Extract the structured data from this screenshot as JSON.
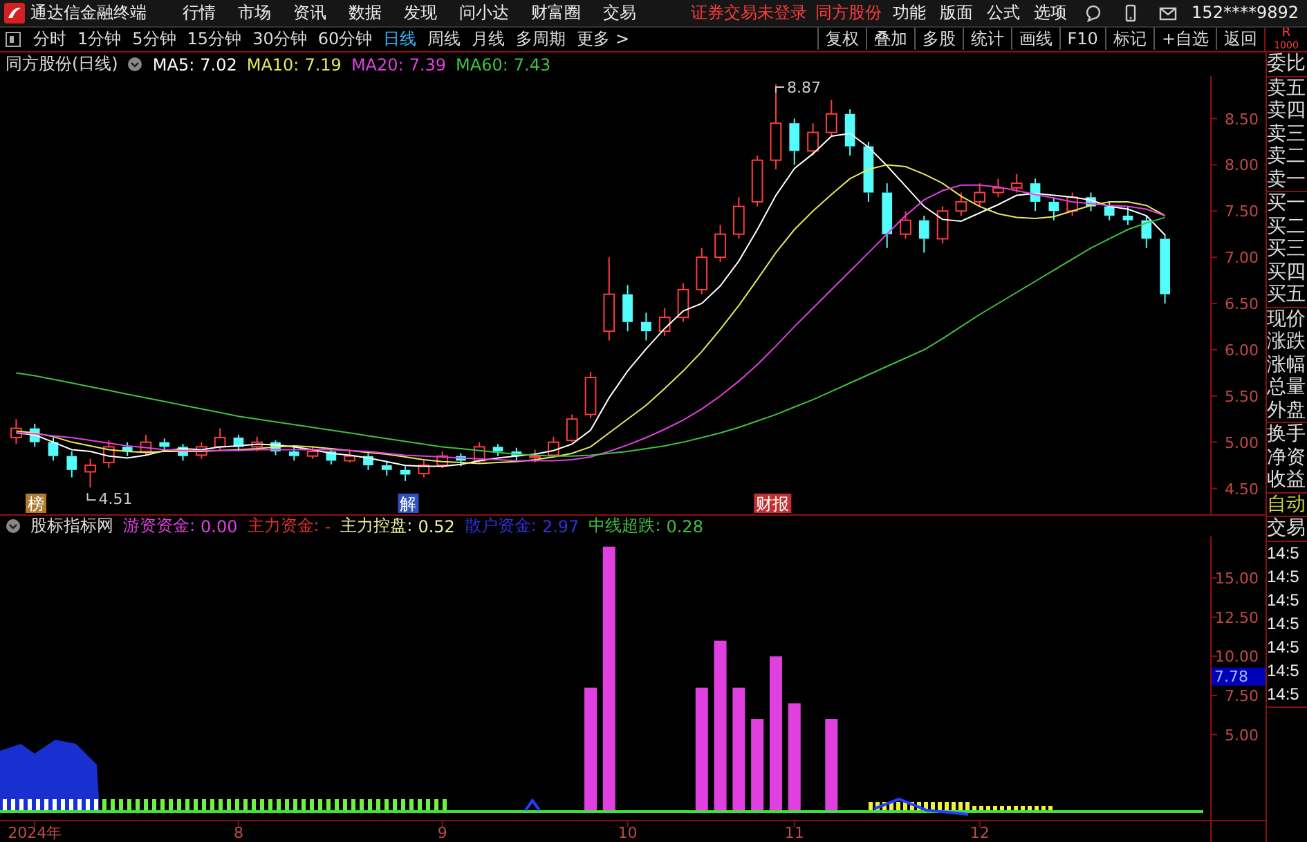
{
  "menubar": {
    "app_title": "通达信金融终端",
    "menus": [
      "行情",
      "市场",
      "资讯",
      "数据",
      "发现",
      "问小达",
      "财富圈",
      "交易"
    ],
    "notices": [
      "证券交易未登录",
      "同方股份"
    ],
    "actions": [
      "功能",
      "版面",
      "公式",
      "选项"
    ],
    "account": "152****9892"
  },
  "toolbar": {
    "periods": [
      {
        "label": "分时",
        "selected": false
      },
      {
        "label": "1分钟",
        "selected": false
      },
      {
        "label": "5分钟",
        "selected": false
      },
      {
        "label": "15分钟",
        "selected": false
      },
      {
        "label": "30分钟",
        "selected": false
      },
      {
        "label": "60分钟",
        "selected": false
      },
      {
        "label": "日线",
        "selected": true
      },
      {
        "label": "周线",
        "selected": false
      },
      {
        "label": "月线",
        "selected": false
      },
      {
        "label": "多周期",
        "selected": false
      },
      {
        "label": "更多 >",
        "selected": false
      }
    ],
    "buttons": [
      "复权",
      "叠加",
      "多股",
      "统计",
      "画线",
      "F10",
      "标记",
      "+自选",
      "返回"
    ],
    "corner": [
      "R",
      "1000"
    ]
  },
  "chart": {
    "title": "同方股份(日线)",
    "legend": [
      {
        "value": "7.02"
      },
      {
        "value": "7.19"
      },
      {
        "value": "7.39"
      },
      {
        "value": "7.43"
      }
    ],
    "events": [
      {
        "text": "榜",
        "color": "#b07a30"
      },
      {
        "text": "解",
        "color": "#3050c0"
      },
      {
        "text": "财报",
        "color": "#c03030"
      }
    ],
    "chart_data": {
      "type": "candlestick",
      "ylim": [
        4.22,
        8.96
      ],
      "categories": [
        null,
        null,
        null,
        null,
        null,
        null,
        null,
        null,
        null,
        null,
        null,
        null,
        null,
        null,
        null,
        null,
        null,
        null,
        null,
        null,
        null,
        null,
        null,
        null,
        null,
        null,
        null,
        null,
        null,
        null,
        null,
        null,
        null,
        null,
        null,
        null,
        null,
        null,
        null,
        null,
        null,
        null,
        null,
        null,
        null,
        null,
        null,
        null,
        null,
        null,
        null,
        null,
        null,
        null,
        null,
        null,
        null,
        null,
        null,
        null,
        null,
        null,
        null
      ],
      "yticks": [
        {
          "value": 4.5,
          "label": "4.50"
        },
        {
          "value": 5,
          "label": "5.00"
        },
        {
          "value": 5.5,
          "label": "5.50"
        },
        {
          "value": 6,
          "label": "6.00"
        },
        {
          "value": 6.5,
          "label": "6.50"
        },
        {
          "value": 7,
          "label": "7.00"
        },
        {
          "value": 7.5,
          "label": "7.50"
        },
        {
          "value": 8,
          "label": "8.00"
        },
        {
          "value": 8.5,
          "label": "8.50"
        }
      ],
      "ohlc": [
        [
          5.05,
          5.25,
          4.98,
          5.15
        ],
        [
          5.15,
          5.2,
          4.95,
          5.0
        ],
        [
          5.0,
          5.05,
          4.8,
          4.85
        ],
        [
          4.85,
          4.9,
          4.62,
          4.7
        ],
        [
          4.68,
          4.82,
          4.51,
          4.75
        ],
        [
          4.78,
          5.02,
          4.72,
          4.95
        ],
        [
          4.95,
          5.0,
          4.85,
          4.9
        ],
        [
          4.9,
          5.08,
          4.86,
          5.0
        ],
        [
          5.0,
          5.04,
          4.9,
          4.95
        ],
        [
          4.95,
          4.98,
          4.8,
          4.85
        ],
        [
          4.86,
          5.0,
          4.82,
          4.95
        ],
        [
          4.95,
          5.15,
          4.9,
          5.05
        ],
        [
          5.05,
          5.08,
          4.9,
          4.95
        ],
        [
          4.95,
          5.06,
          4.9,
          5.0
        ],
        [
          5.0,
          5.02,
          4.86,
          4.9
        ],
        [
          4.9,
          4.95,
          4.8,
          4.85
        ],
        [
          4.85,
          4.96,
          4.82,
          4.9
        ],
        [
          4.9,
          4.93,
          4.76,
          4.8
        ],
        [
          4.8,
          4.92,
          4.78,
          4.85
        ],
        [
          4.85,
          4.88,
          4.7,
          4.75
        ],
        [
          4.75,
          4.8,
          4.64,
          4.7
        ],
        [
          4.7,
          4.74,
          4.58,
          4.65
        ],
        [
          4.66,
          4.8,
          4.62,
          4.75
        ],
        [
          4.75,
          4.9,
          4.72,
          4.85
        ],
        [
          4.85,
          4.88,
          4.74,
          4.8
        ],
        [
          4.8,
          5.0,
          4.78,
          4.95
        ],
        [
          4.95,
          4.98,
          4.85,
          4.9
        ],
        [
          4.9,
          4.94,
          4.8,
          4.85
        ],
        [
          4.84,
          4.92,
          4.78,
          4.85
        ],
        [
          4.86,
          5.06,
          4.84,
          5.0
        ],
        [
          5.02,
          5.3,
          5.0,
          5.25
        ],
        [
          5.3,
          5.76,
          5.26,
          5.7
        ],
        [
          6.2,
          7.0,
          6.1,
          6.6
        ],
        [
          6.6,
          6.7,
          6.2,
          6.3
        ],
        [
          6.3,
          6.4,
          6.1,
          6.2
        ],
        [
          6.2,
          6.45,
          6.15,
          6.35
        ],
        [
          6.35,
          6.72,
          6.3,
          6.65
        ],
        [
          6.65,
          7.1,
          6.6,
          7.0
        ],
        [
          7.0,
          7.35,
          6.95,
          7.25
        ],
        [
          7.25,
          7.65,
          7.2,
          7.55
        ],
        [
          7.6,
          8.1,
          7.55,
          8.05
        ],
        [
          8.05,
          8.87,
          7.95,
          8.45
        ],
        [
          8.45,
          8.5,
          8.0,
          8.15
        ],
        [
          8.15,
          8.45,
          8.1,
          8.35
        ],
        [
          8.35,
          8.7,
          8.3,
          8.55
        ],
        [
          8.55,
          8.6,
          8.1,
          8.2
        ],
        [
          8.2,
          8.25,
          7.6,
          7.7
        ],
        [
          7.7,
          7.8,
          7.1,
          7.25
        ],
        [
          7.25,
          7.5,
          7.2,
          7.4
        ],
        [
          7.4,
          7.45,
          7.05,
          7.2
        ],
        [
          7.2,
          7.55,
          7.15,
          7.5
        ],
        [
          7.5,
          7.7,
          7.45,
          7.6
        ],
        [
          7.6,
          7.8,
          7.55,
          7.7
        ],
        [
          7.7,
          7.85,
          7.65,
          7.75
        ],
        [
          7.75,
          7.9,
          7.7,
          7.8
        ],
        [
          7.8,
          7.85,
          7.5,
          7.6
        ],
        [
          7.6,
          7.65,
          7.4,
          7.5
        ],
        [
          7.5,
          7.7,
          7.45,
          7.65
        ],
        [
          7.65,
          7.7,
          7.5,
          7.55
        ],
        [
          7.55,
          7.6,
          7.4,
          7.45
        ],
        [
          7.45,
          7.55,
          7.35,
          7.4
        ],
        [
          7.4,
          7.45,
          7.1,
          7.2
        ],
        [
          7.2,
          7.25,
          6.5,
          6.6
        ]
      ],
      "series": [
        {
          "name": "MA5:",
          "type": "line",
          "color": "#ffffff",
          "values": [
            5.1,
            5.08,
            5.0,
            4.92,
            4.9,
            4.85,
            4.83,
            4.86,
            4.91,
            4.93,
            4.92,
            4.95,
            4.96,
            4.98,
            4.97,
            4.95,
            4.92,
            4.88,
            4.86,
            4.83,
            4.79,
            4.75,
            4.74,
            4.74,
            4.76,
            4.8,
            4.83,
            4.85,
            4.87,
            4.91,
            4.98,
            5.13,
            5.48,
            5.77,
            6.01,
            6.23,
            6.42,
            6.5,
            6.69,
            6.96,
            7.3,
            7.67,
            7.96,
            8.12,
            8.31,
            8.34,
            8.19,
            7.99,
            7.77,
            7.55,
            7.41,
            7.39,
            7.48,
            7.57,
            7.67,
            7.69,
            7.67,
            7.65,
            7.62,
            7.55,
            7.52,
            7.45,
            7.24
          ]
        },
        {
          "name": "MA10:",
          "type": "line",
          "color": "#e8e85a",
          "values": [
            5.12,
            5.1,
            5.06,
            5.0,
            4.96,
            4.92,
            4.9,
            4.89,
            4.9,
            4.9,
            4.9,
            4.91,
            4.92,
            4.93,
            4.95,
            4.96,
            4.95,
            4.93,
            4.91,
            4.89,
            4.87,
            4.84,
            4.81,
            4.79,
            4.78,
            4.77,
            4.78,
            4.79,
            4.81,
            4.84,
            4.88,
            4.95,
            5.1,
            5.25,
            5.4,
            5.58,
            5.77,
            5.98,
            6.22,
            6.48,
            6.76,
            7.05,
            7.3,
            7.5,
            7.68,
            7.85,
            7.95,
            8.0,
            7.98,
            7.9,
            7.8,
            7.66,
            7.55,
            7.47,
            7.43,
            7.42,
            7.44,
            7.5,
            7.56,
            7.6,
            7.6,
            7.56,
            7.45
          ]
        },
        {
          "name": "MA20:",
          "type": "line",
          "color": "#e040e0",
          "values": [
            5.1,
            5.09,
            5.07,
            5.05,
            5.02,
            4.99,
            4.96,
            4.94,
            4.92,
            4.91,
            4.91,
            4.91,
            4.91,
            4.92,
            4.92,
            4.92,
            4.92,
            4.92,
            4.91,
            4.9,
            4.88,
            4.86,
            4.85,
            4.84,
            4.83,
            4.82,
            4.81,
            4.8,
            4.8,
            4.8,
            4.81,
            4.84,
            4.9,
            4.97,
            5.05,
            5.14,
            5.24,
            5.36,
            5.5,
            5.66,
            5.84,
            6.04,
            6.25,
            6.45,
            6.65,
            6.85,
            7.05,
            7.25,
            7.45,
            7.62,
            7.72,
            7.78,
            7.78,
            7.76,
            7.72,
            7.68,
            7.64,
            7.6,
            7.58,
            7.56,
            7.55,
            7.52,
            7.45
          ]
        },
        {
          "name": "MA60:",
          "type": "line",
          "color": "#40c040",
          "values": [
            5.75,
            5.72,
            5.68,
            5.64,
            5.6,
            5.56,
            5.52,
            5.48,
            5.44,
            5.4,
            5.36,
            5.32,
            5.28,
            5.25,
            5.22,
            5.19,
            5.16,
            5.13,
            5.1,
            5.07,
            5.04,
            5.01,
            4.98,
            4.95,
            4.93,
            4.91,
            4.89,
            4.87,
            4.86,
            4.85,
            4.85,
            4.86,
            4.88,
            4.9,
            4.93,
            4.96,
            5.0,
            5.05,
            5.1,
            5.16,
            5.23,
            5.3,
            5.38,
            5.46,
            5.55,
            5.64,
            5.73,
            5.82,
            5.91,
            6.0,
            6.12,
            6.25,
            6.38,
            6.5,
            6.62,
            6.74,
            6.86,
            6.98,
            7.1,
            7.2,
            7.3,
            7.37,
            7.43
          ]
        }
      ],
      "annotations": [
        "8.87",
        "4.51"
      ]
    }
  },
  "indicator": {
    "title": "股标指标网",
    "legend": [
      {
        "value": "0.00"
      },
      {
        "name": "主力资金:",
        "value": "-",
        "color": "#e03030"
      },
      {
        "name": "主力控盘:",
        "value": "0.52",
        "color": "#f0f0a0"
      },
      {
        "name": "散户资金:",
        "value": "2.97",
        "color": "#3030e0"
      },
      {
        "name": "中线超跌:",
        "value": "0.28",
        "color": "#40c040"
      }
    ],
    "current_value": "7.78",
    "chart_data": {
      "type": "bar",
      "ylim": [
        0,
        17.65
      ],
      "categories": [
        null,
        "2024年",
        null,
        null,
        null,
        null,
        null,
        null,
        null,
        null,
        null,
        null,
        "8",
        null,
        null,
        null,
        null,
        null,
        null,
        null,
        null,
        null,
        null,
        "9",
        null,
        null,
        null,
        null,
        null,
        null,
        null,
        null,
        null,
        "10",
        null,
        null,
        null,
        null,
        null,
        null,
        null,
        null,
        "11",
        null,
        null,
        null,
        null,
        null,
        null,
        null,
        null,
        null,
        "12",
        null,
        null,
        null,
        null,
        null,
        null,
        null,
        null,
        null,
        null
      ],
      "yticks": [
        {
          "value": 5,
          "label": "5.00"
        },
        {
          "value": 7.5,
          "label": "7.50"
        },
        {
          "value": 10,
          "label": "10.00"
        },
        {
          "value": 12.5,
          "label": "12.50"
        },
        {
          "value": 15,
          "label": "15.00"
        }
      ],
      "series": [
        {
          "name": "游资资金:",
          "color": "#e040e0",
          "values": [
            0,
            0,
            0,
            0,
            0,
            0,
            0,
            0,
            0,
            0,
            0,
            0,
            0,
            0,
            0,
            0,
            0,
            0,
            0,
            0,
            0,
            0,
            0,
            0,
            0,
            0,
            0,
            0,
            0,
            0,
            0,
            8,
            17,
            0,
            0,
            0,
            0,
            8,
            11,
            8,
            6,
            10,
            7,
            0,
            6,
            0,
            0,
            0,
            0,
            0,
            0,
            0,
            0,
            0,
            0,
            0,
            0,
            0,
            0,
            0,
            0,
            0,
            0
          ]
        }
      ]
    }
  },
  "side_panel": {
    "groups": [
      {
        "kind": "label",
        "items": [
          "委比"
        ]
      },
      {
        "kind": "label",
        "items": [
          "卖五",
          "卖四",
          "卖三",
          "卖二",
          "卖一"
        ]
      },
      {
        "kind": "label",
        "items": [
          "买一",
          "买二",
          "买三",
          "买四",
          "买五"
        ]
      },
      {
        "kind": "label",
        "items": [
          "现价",
          "涨跌",
          "涨幅",
          "总量",
          "外盘"
        ]
      },
      {
        "kind": "label",
        "items": [
          "换手",
          "净资",
          "收益"
        ]
      },
      {
        "kind": "mode",
        "items": [
          "自动"
        ]
      },
      {
        "kind": "label",
        "items": [
          "交易"
        ]
      },
      {
        "kind": "time",
        "items": [
          "14:5",
          "14:5",
          "14:5",
          "14:5",
          "14:5",
          "14:5",
          "14:5"
        ]
      }
    ]
  }
}
